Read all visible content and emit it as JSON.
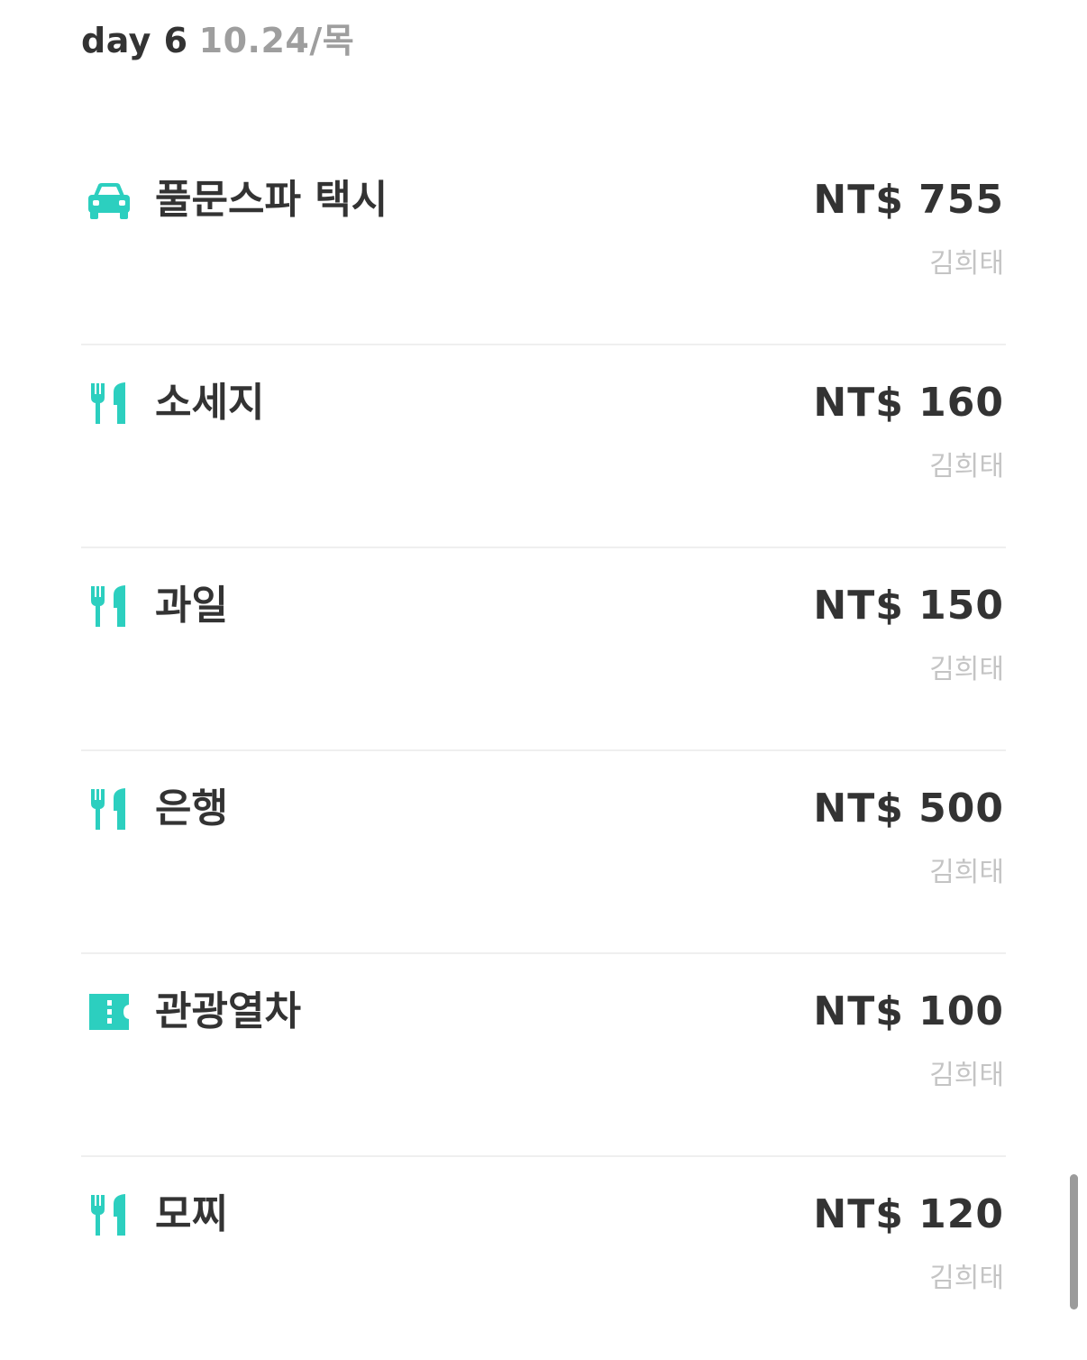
{
  "day": {
    "label": "day 6",
    "date": "10.24/목"
  },
  "accent_color": "#2ccfbf",
  "expenses": [
    {
      "icon": "car-icon",
      "title": "풀문스파 택시",
      "amount": "NT$ 755",
      "payer": "김희태"
    },
    {
      "icon": "fork-knife-icon",
      "title": "소세지",
      "amount": "NT$ 160",
      "payer": "김희태"
    },
    {
      "icon": "fork-knife-icon",
      "title": "과일",
      "amount": "NT$ 150",
      "payer": "김희태"
    },
    {
      "icon": "fork-knife-icon",
      "title": "은행",
      "amount": "NT$ 500",
      "payer": "김희태"
    },
    {
      "icon": "ticket-icon",
      "title": "관광열차",
      "amount": "NT$ 100",
      "payer": "김희태"
    },
    {
      "icon": "fork-knife-icon",
      "title": "모찌",
      "amount": "NT$ 120",
      "payer": "김희태"
    }
  ]
}
